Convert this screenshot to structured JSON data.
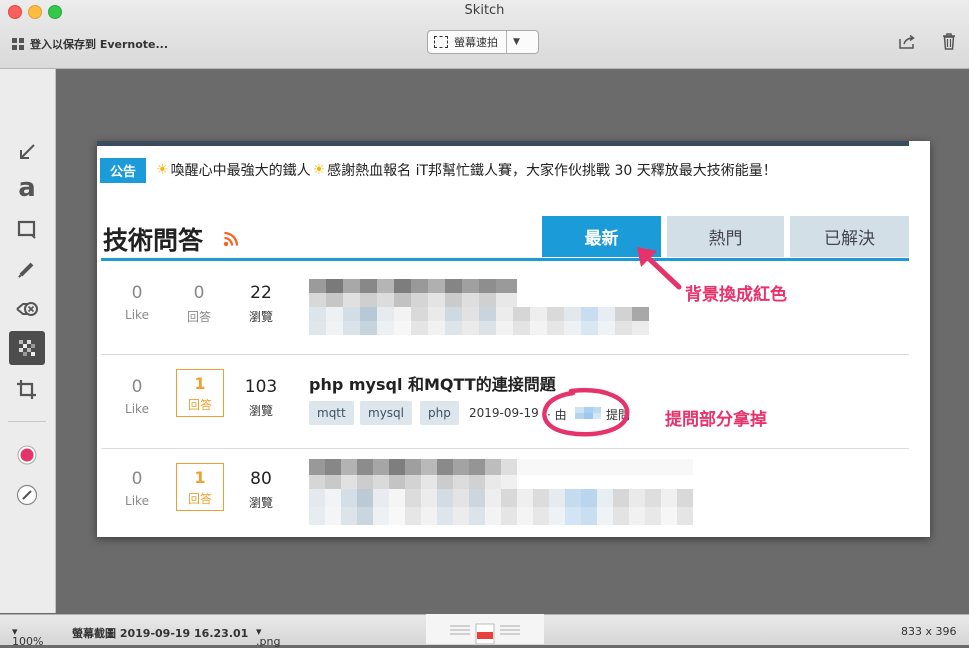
{
  "window": {
    "title": "Skitch"
  },
  "top_toolbar": {
    "evernote_label": "登入以保存到 Evernote...",
    "capture_label": "螢幕速拍"
  },
  "statusbar": {
    "zoom": "100%",
    "filename": "螢幕截圖 2019-09-19 16.23.01",
    "format": ".png",
    "dimensions": "833 x 396"
  },
  "canvas": {
    "notice": {
      "badge": "公告",
      "text_1": "喚醒心中最強大的鐵人",
      "text_2": "感謝熱血報名 iT邦幫忙鐵人賽，大家作伙挑戰 30 天釋放最大技術能量！"
    },
    "section_title": "技術問答",
    "tabs": [
      {
        "label": "最新"
      },
      {
        "label": "熱門"
      },
      {
        "label": "已解決"
      }
    ],
    "questions": [
      {
        "likes": "0",
        "like_label": "Like",
        "answers": "0",
        "answer_label": "回答",
        "views": "22",
        "view_label": "瀏覽"
      },
      {
        "likes": "0",
        "like_label": "Like",
        "answers": "1",
        "answer_label": "回答",
        "views": "103",
        "view_label": "瀏覽",
        "title": "php mysql 和MQTT的連接問題",
        "tags": [
          "mqtt",
          "mysql",
          "php"
        ],
        "date": "2019-09-19",
        "by": "· 由",
        "asked": "提問"
      },
      {
        "likes": "0",
        "like_label": "Like",
        "answers": "1",
        "answer_label": "回答",
        "views": "80",
        "view_label": "瀏覽"
      }
    ],
    "annotations": {
      "red_bg_note": "背景換成紅色",
      "remove_note": "提問部分拿掉"
    }
  },
  "colors": {
    "accent": "#1b9bd7",
    "annotation": "#e6336b",
    "answer_orange": "#f0a030"
  }
}
